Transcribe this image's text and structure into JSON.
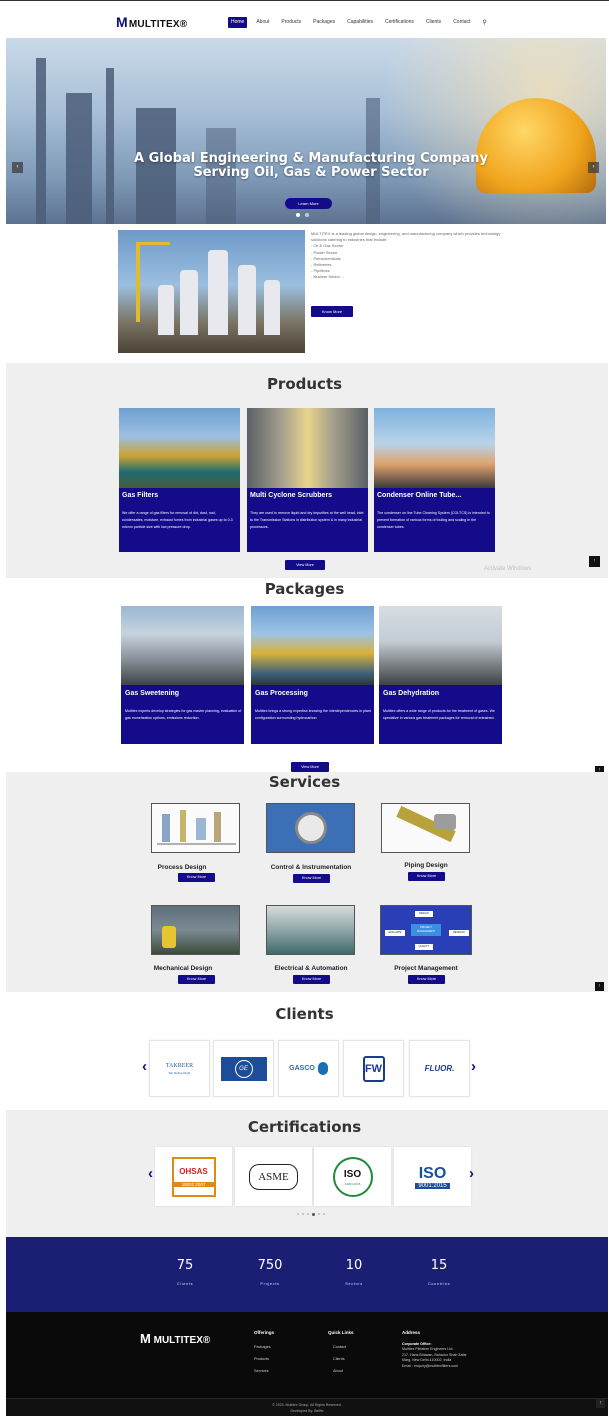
{
  "header": {
    "logo_text": "MULTITEX",
    "nav": [
      "Home",
      "About",
      "Products",
      "Packages",
      "Capabilities",
      "Certifications",
      "Clients",
      "Contact"
    ],
    "active": "Home"
  },
  "hero": {
    "title": "A Global Engineering & Manufacturing Company Serving Oil, Gas & Power Sector",
    "button": "Learn More",
    "prev_icon": "chevron-left-icon",
    "next_icon": "chevron-right-icon"
  },
  "about": {
    "text": "MULTITEX is a leading global design, engineering, and manufacturing company which provides technology solutions catering to industries that include:",
    "items": [
      "- Oil & Gas Sector",
      "- Power Sector",
      "- Petrochemicals",
      "- Refineries",
      "- Pipelines",
      "- Nuclear Sector ..."
    ],
    "button": "Know More"
  },
  "products": {
    "title": "Products",
    "cards": [
      {
        "title": "Gas Filters",
        "desc": "We offer a range of gas filters for removal of dirt, dust, rust, condensates, moisture, exhaust fumes from industrial gases up to 0.3 micron particle size with low pressure drop."
      },
      {
        "title": "Multi Cyclone Scrubbers",
        "desc": "They are used to remove liquid and dry impurities at the well head, inlet to the Transmission Stations in distribution system & in many industrial processors."
      },
      {
        "title": "Condenser Online Tube...",
        "desc": "The condenser on line Tube Cleaning System (COLTCS) is intended to prevent formation of various forms of fouling and scaling in the condenser tubes."
      }
    ],
    "button": "View More"
  },
  "packages": {
    "title": "Packages",
    "cards": [
      {
        "title": "Gas Sweetening",
        "desc": "Multitex experts develop strategies for gas master planning, evaluation of gas monetization options, emissions reduction."
      },
      {
        "title": "Gas Processing",
        "desc": "Multitex brings a strong expertise knowing the interdependencies in plant configuration surrounding hydrocarbon"
      },
      {
        "title": "Gas Dehydration",
        "desc": "Multitex offers a wide range of products for the treatment of gases. We specialize in various gas treatment packages for removal of entrained."
      }
    ],
    "button": "View More"
  },
  "services": {
    "title": "Services",
    "items": [
      {
        "name": "Process Design",
        "button": "Know More"
      },
      {
        "name": "Control & Instrumentation",
        "button": "Know More"
      },
      {
        "name": "Piping Design",
        "button": "Know More"
      },
      {
        "name": "Mechanical Design",
        "button": "Know More"
      },
      {
        "name": "Electrical & Automation",
        "button": "Know More"
      },
      {
        "name": "Project Management",
        "button": "Know More"
      }
    ],
    "pm_diagram": [
      "DESIGN",
      "PROJECT MANAGEMENT",
      "EVALUATE",
      "DEVELOP",
      "QUALITY"
    ]
  },
  "clients": {
    "title": "Clients",
    "logos": [
      "TAKREER",
      "GE",
      "GASCO",
      "FW",
      "FLUOR."
    ],
    "takreer_tagline": "We Refine Right"
  },
  "certifications": {
    "title": "Certifications",
    "logos": [
      {
        "top": "OHSAS",
        "bottom": "18001:2007"
      },
      {
        "top": "ASME",
        "bottom": ""
      },
      {
        "top": "ISO",
        "bottom": "14001:2015"
      },
      {
        "top": "ISO",
        "bottom": "9001:2015"
      }
    ]
  },
  "stats": [
    {
      "num": "75",
      "label": "Clients"
    },
    {
      "num": "750",
      "label": "Projects"
    },
    {
      "num": "10",
      "label": "Sectors"
    },
    {
      "num": "15",
      "label": "Countries"
    }
  ],
  "footer": {
    "logo_text": "MULTITEX",
    "offerings_head": "Offerings",
    "offerings": [
      "Packages",
      "Products",
      "Services"
    ],
    "quick_head": "Quick Links",
    "quick": [
      "Contact",
      "Clients",
      "About"
    ],
    "address_head": "Address",
    "corp_office": "Corporate Office:",
    "address_lines": [
      "Multitex Filtration Engineers Ltd.",
      "217, Hans Bhawan, Bahadur Shah Zafar",
      "Marg, New Delhi-110002, India",
      "Email : enquiry@multitexfilters.com"
    ],
    "copyright": "© 2023. Multitex Group. All Rights Reserved.",
    "developed": "Developed By: Bellfix"
  },
  "watermark": "Activate Windows"
}
